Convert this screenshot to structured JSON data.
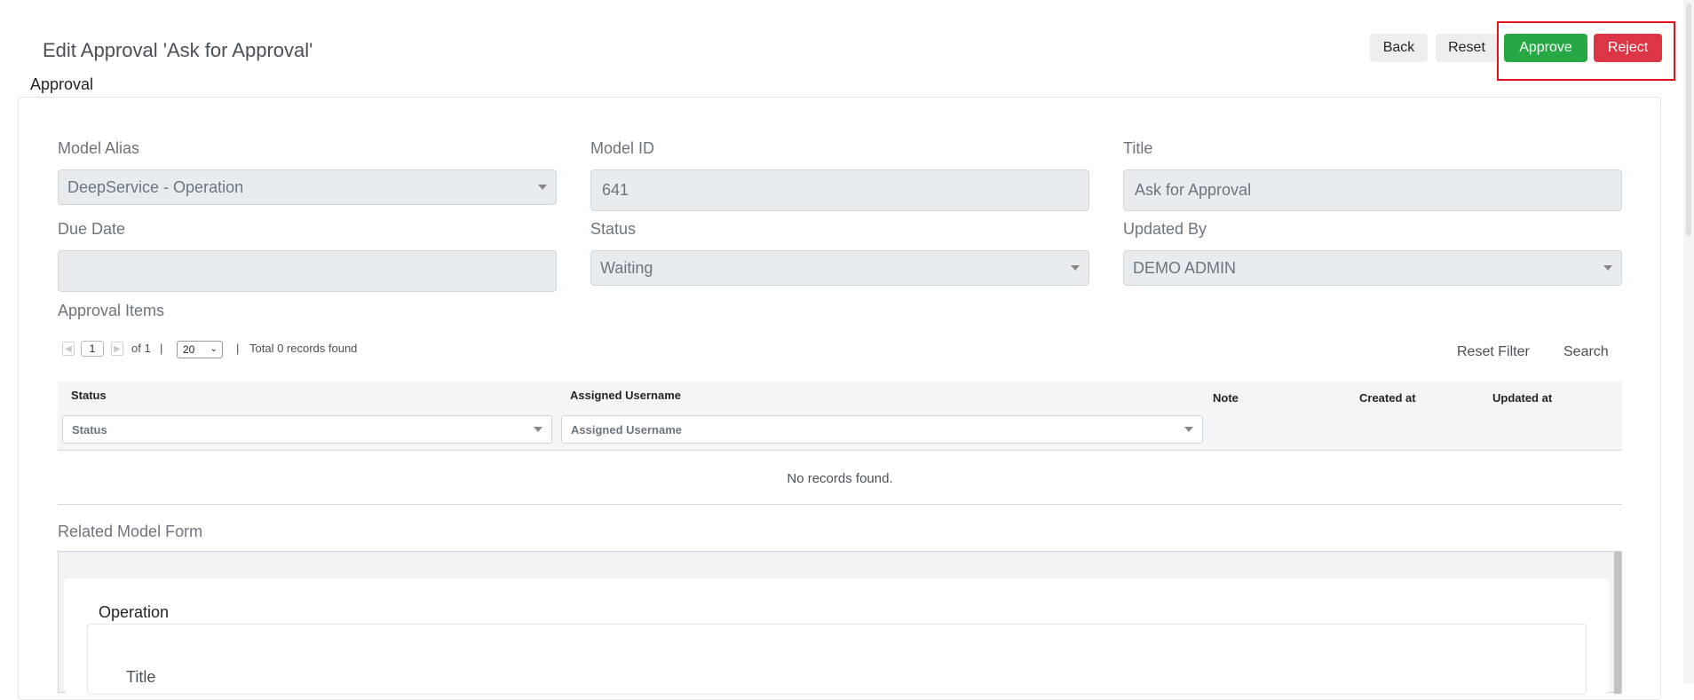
{
  "header": {
    "title": "Edit Approval 'Ask for Approval'",
    "section": "Approval",
    "buttons": {
      "back": "Back",
      "reset": "Reset",
      "approve": "Approve",
      "reject": "Reject"
    }
  },
  "form": {
    "model_alias": {
      "label": "Model Alias",
      "value": "DeepService - Operation"
    },
    "model_id": {
      "label": "Model ID",
      "value": "641"
    },
    "title": {
      "label": "Title",
      "value": "Ask for Approval"
    },
    "due_date": {
      "label": "Due Date",
      "value": ""
    },
    "status": {
      "label": "Status",
      "value": "Waiting"
    },
    "updated_by": {
      "label": "Updated By",
      "value": "DEMO ADMIN"
    }
  },
  "approval_items": {
    "label": "Approval Items",
    "pager": {
      "page": "1",
      "of": "of 1",
      "sep1": "|",
      "page_size": "20",
      "sep2": "|",
      "total": "Total 0 records found"
    },
    "actions": {
      "reset_filter": "Reset Filter",
      "search": "Search"
    },
    "columns": [
      "Status",
      "Assigned Username",
      "Note",
      "Created at",
      "Updated at"
    ],
    "filters": {
      "status_placeholder": "Status",
      "assigned_placeholder": "Assigned Username"
    },
    "empty": "No records found."
  },
  "related": {
    "label": "Related Model Form",
    "inner_title": "Operation",
    "field_label": "Title"
  }
}
